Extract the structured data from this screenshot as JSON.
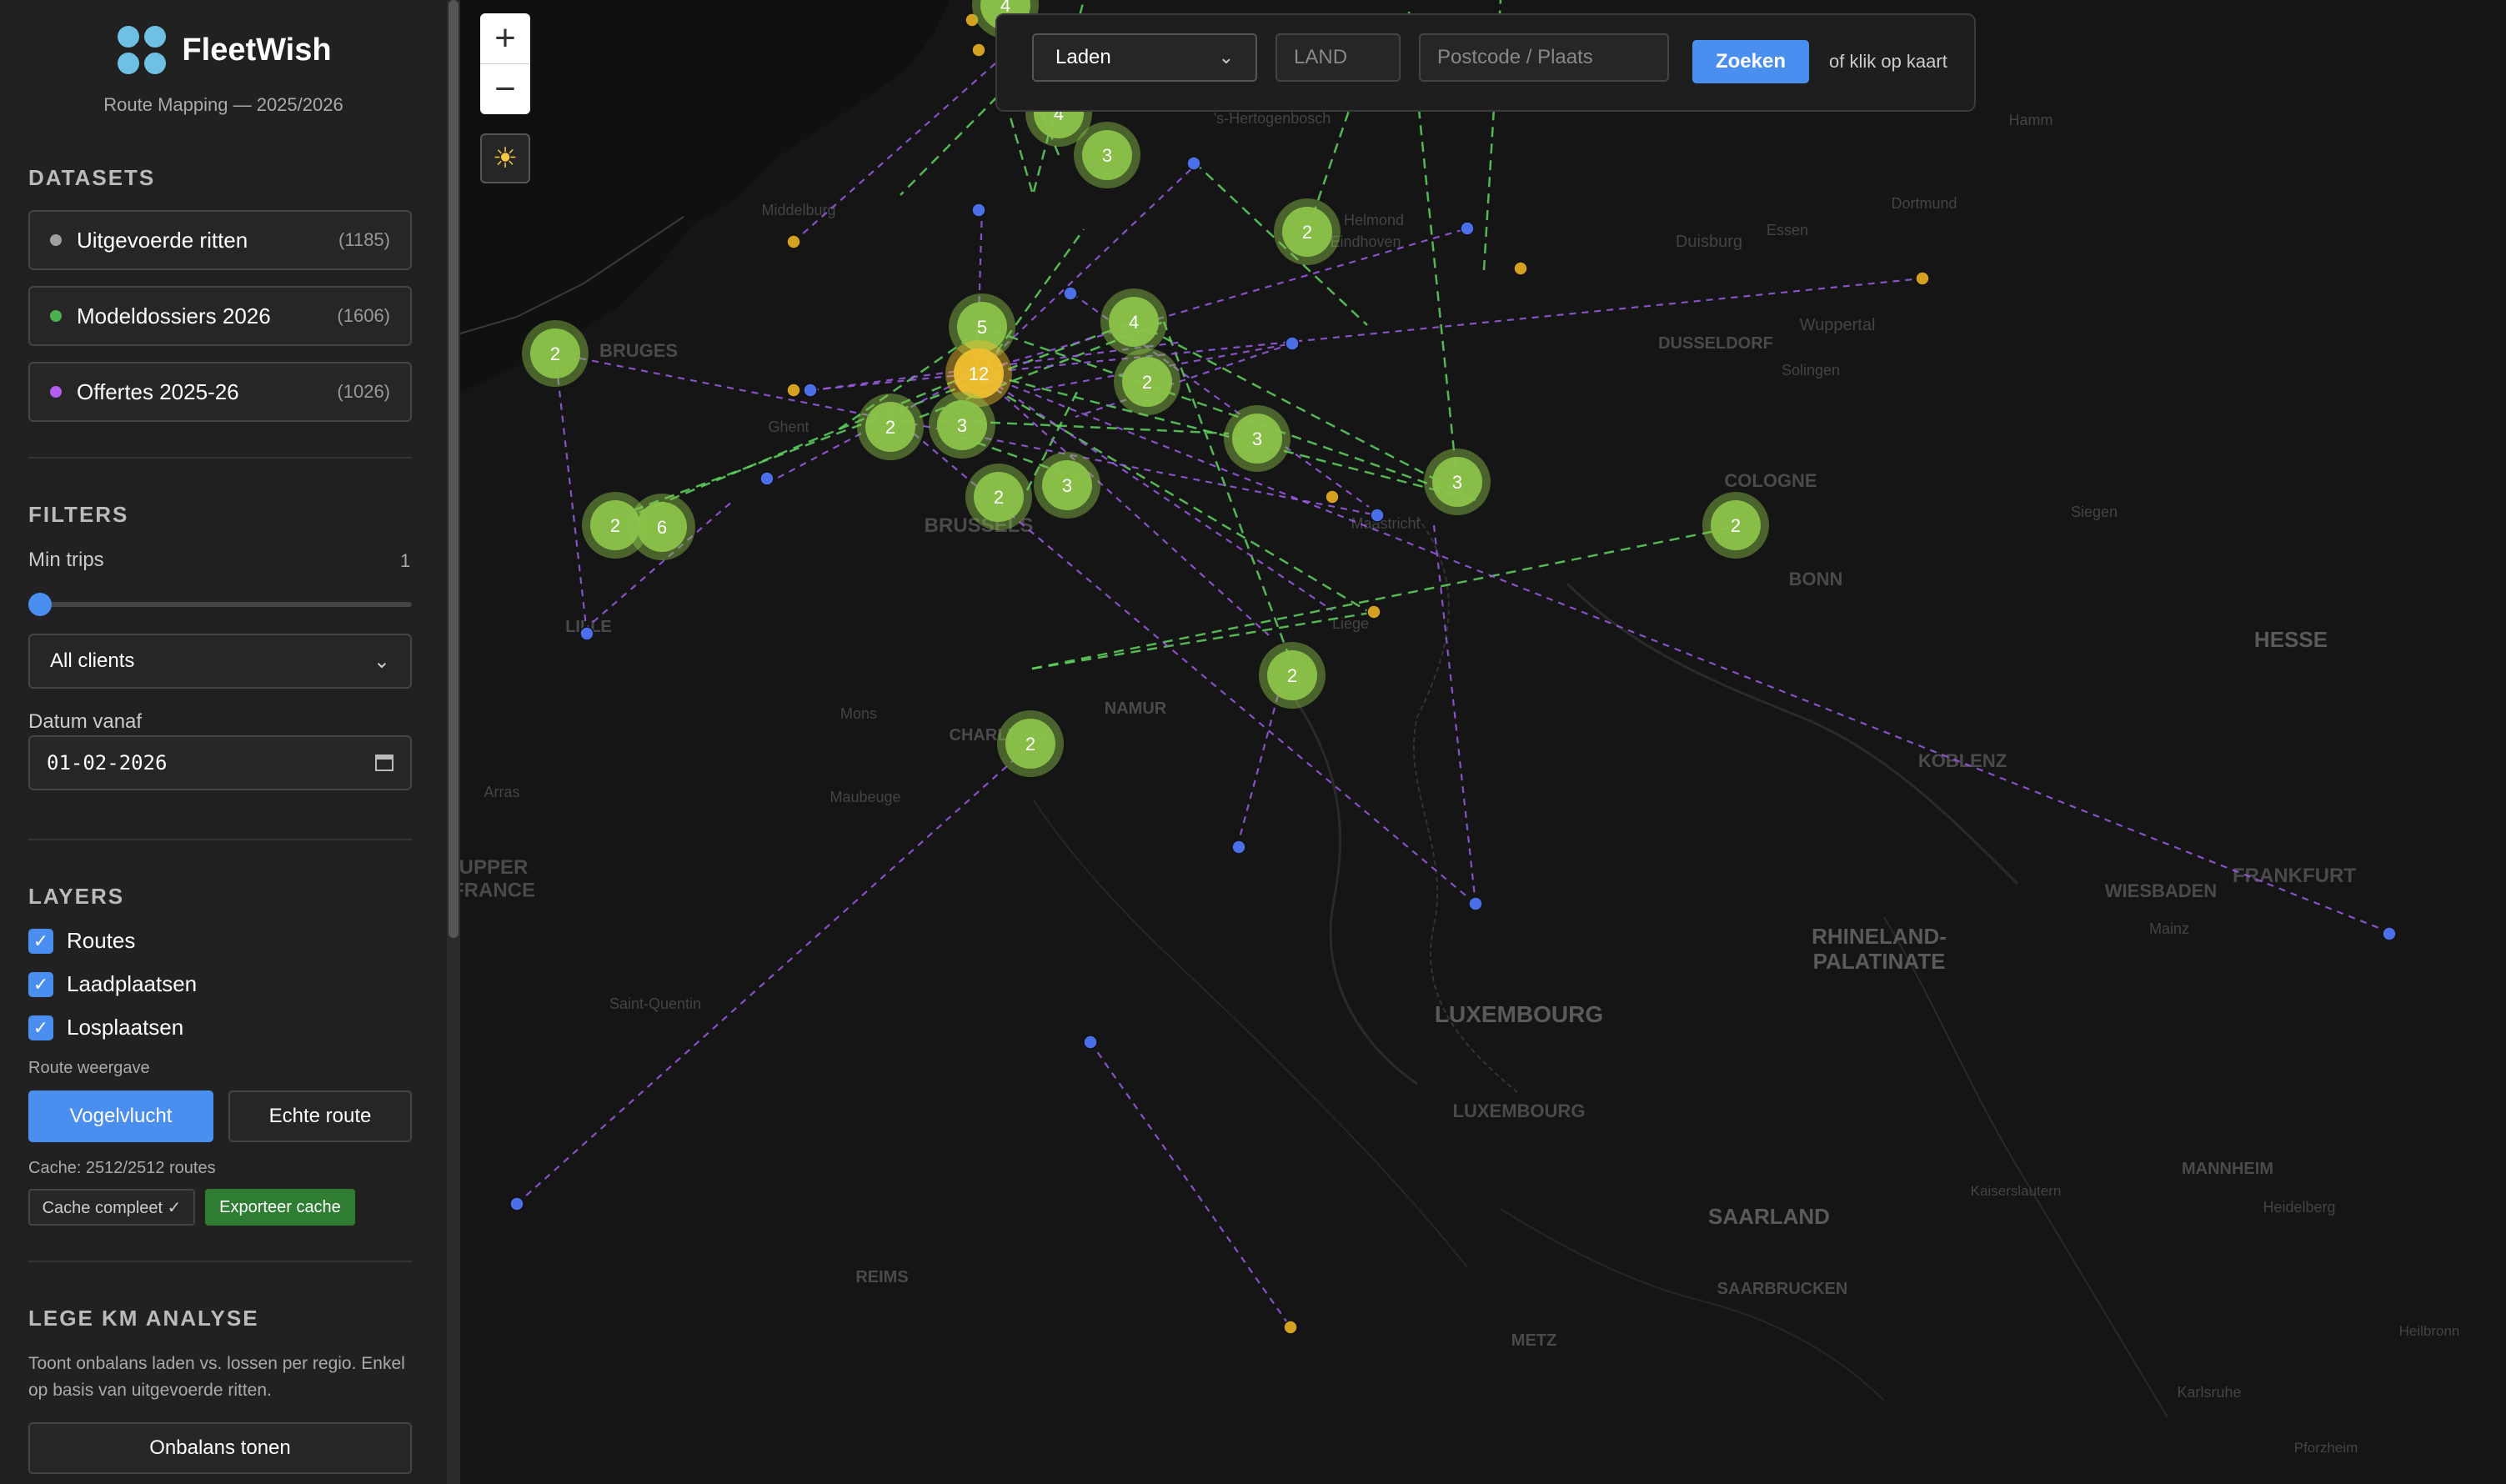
{
  "app": {
    "name": "FleetWish",
    "subtitle": "Route Mapping — 2025/2026"
  },
  "datasets": {
    "title": "DATASETS",
    "items": [
      {
        "label": "Uitgevoerde ritten",
        "count": "(1185)",
        "color": "#9e9e9e"
      },
      {
        "label": "Modeldossiers 2026",
        "count": "(1606)",
        "color": "#4caf50"
      },
      {
        "label": "Offertes 2025-26",
        "count": "(1026)",
        "color": "#b25cf0"
      }
    ]
  },
  "filters": {
    "title": "FILTERS",
    "min_trips_label": "Min trips",
    "min_trips_value": "1",
    "client_select": "All clients",
    "date_label": "Datum vanaf",
    "date_value": "01-02-2026"
  },
  "layers": {
    "title": "LAYERS",
    "items": [
      "Routes",
      "Laadplaatsen",
      "Losplaatsen"
    ],
    "route_label": "Route weergave",
    "btn_vogelvlucht": "Vogelvlucht",
    "btn_echte_route": "Echte route",
    "cache_text": "Cache: 2512/2512 routes",
    "cache_complete": "Cache compleet ✓",
    "export_cache": "Exporteer cache"
  },
  "lege_km": {
    "title": "LEGE KM ANALYSE",
    "desc": "Toont onbalans laden vs. lossen per regio. Enkel op basis van uitgevoerde ritten.",
    "button": "Onbalans tonen"
  },
  "search": {
    "mode": "Laden",
    "land_placeholder": "LAND",
    "postcode_placeholder": "Postcode / Plaats",
    "button": "Zoeken",
    "hint": "of klik op kaart"
  },
  "map_labels": {
    "countries": [
      "HESSE",
      "RHINELAND-\nPALATINATE",
      "SAARLAND",
      "LUXEMBOURG"
    ],
    "cities": [
      "Middelburg",
      "BRUGES",
      "Ghent",
      "BRUSSELS",
      "LILLE",
      "Mons",
      "Maubeuge",
      "CHARLEROI",
      "NAMUR",
      "Liege",
      "Maastricht",
      "Helmond",
      "Eindhoven",
      "'s-Hertogenbosch",
      "Hamm",
      "Dortmund",
      "Duisburg",
      "Essen",
      "Wuppertal",
      "DUSSELDORF",
      "Solingen",
      "COLOGNE",
      "BONN",
      "Siegen",
      "KOBLENZ",
      "WIESBADEN",
      "FRANKFURT",
      "Mainz",
      "Arras",
      "UPPER\nFRANCE",
      "Saint-Quentin",
      "REIMS",
      "LUXEMBOURG",
      "SAARBRUCKEN",
      "METZ",
      "Kaiserslautern",
      "MANNHEIM",
      "Heidelberg",
      "Heilbronn",
      "Karlsruhe",
      "Pforzheim"
    ]
  },
  "clusters": [
    "4",
    "4",
    "3",
    "2",
    "2",
    "5",
    "12",
    "4",
    "2",
    "2",
    "3",
    "3",
    "3",
    "3",
    "2",
    "2",
    "6",
    "2",
    "2",
    "2"
  ],
  "colors": {
    "accent": "#4a8ff0",
    "cluster_green": "#8bc34a",
    "cluster_yellow": "#f0c030",
    "load": "#d4a020",
    "unload": "#4a6fe8",
    "route_green": "#5fd35f",
    "route_purple": "#9b5de5"
  }
}
